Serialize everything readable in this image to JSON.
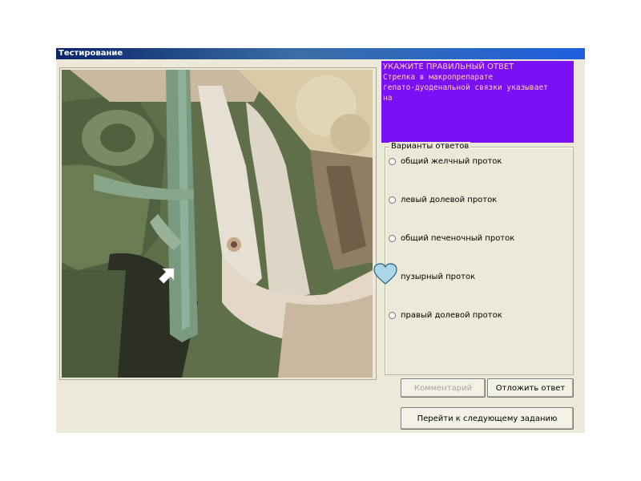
{
  "window": {
    "title": "Тестирование"
  },
  "question": {
    "heading": "УКАЖИТЕ ПРАВИЛЬНЫЙ ОТВЕТ",
    "text": "Стрелка в макропрепарате\nгепато-дуоденальной связки указывает\nна"
  },
  "answers": {
    "group_title": "Варианты ответов",
    "options": [
      {
        "label": "общий желчный проток"
      },
      {
        "label": "левый долевой проток"
      },
      {
        "label": "общий печеночный проток"
      },
      {
        "label": "пузырный проток"
      },
      {
        "label": "правый долевой проток"
      }
    ]
  },
  "buttons": {
    "comment": "Комментарий",
    "postpone": "Отложить ответ",
    "next": "Перейти к следующему заданию"
  },
  "colors": {
    "question_bg": "#7b0ff5",
    "question_text": "#ffd1ad",
    "window_bg": "#ece9d8",
    "cursor_fill": "#a9d7e8"
  },
  "icons": {
    "arrow": "white-arrow-pointer",
    "cursor": "heart-shaped-cursor"
  }
}
